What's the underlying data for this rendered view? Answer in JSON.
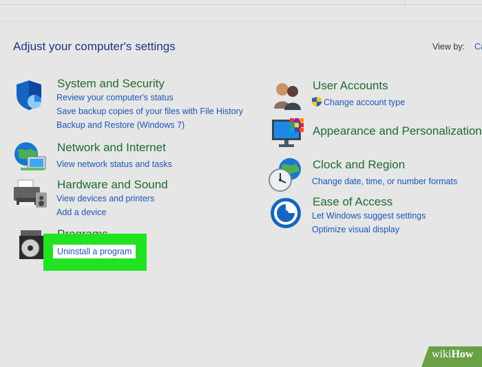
{
  "header": {
    "title": "Adjust your computer's settings",
    "view_by_label": "View by:",
    "view_by_value": "Ca"
  },
  "left": [
    {
      "title": "System and Security",
      "links": [
        "Review your computer's status",
        "Save backup copies of your files with File History",
        "Backup and Restore (Windows 7)"
      ]
    },
    {
      "title": "Network and Internet",
      "links": [
        "View network status and tasks"
      ]
    },
    {
      "title": "Hardware and Sound",
      "links": [
        "View devices and printers",
        "Add a device"
      ]
    },
    {
      "title": "Programs",
      "links": [
        "Uninstall a program"
      ]
    }
  ],
  "right": [
    {
      "title": "User Accounts",
      "links": [
        "Change account type"
      ]
    },
    {
      "title": "Appearance and Personalization",
      "links": []
    },
    {
      "title": "Clock and Region",
      "links": [
        "Change date, time, or number formats"
      ]
    },
    {
      "title": "Ease of Access",
      "links": [
        "Let Windows suggest settings",
        "Optimize visual display"
      ]
    }
  ],
  "watermark": {
    "prefix": "wiki",
    "suffix": "How"
  },
  "colors": {
    "background": "#e6e6e6",
    "category_title": "#1d6b2f",
    "link": "#1b55b8",
    "highlight": "#22e322"
  }
}
